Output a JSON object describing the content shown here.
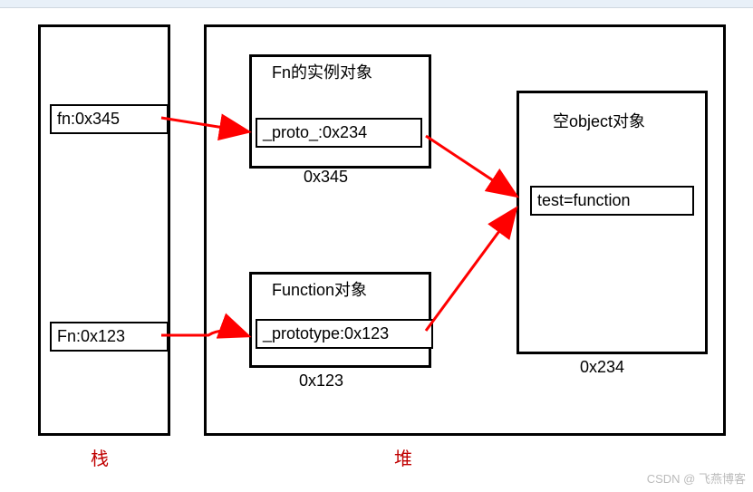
{
  "stack": {
    "label": "栈",
    "fn_entry": "fn:0x345",
    "Fn_entry": "Fn:0x123"
  },
  "heap": {
    "label": "堆",
    "instance": {
      "title": "Fn的实例对象",
      "proto_field": "_proto_:0x234",
      "address": "0x345"
    },
    "function_obj": {
      "title": "Function对象",
      "prototype_field": "_prototype:0x123",
      "address": "0x123"
    },
    "object": {
      "title": "空object对象",
      "test_field": "test=function",
      "address": "0x234"
    }
  },
  "watermark": "CSDN @ 飞燕博客"
}
